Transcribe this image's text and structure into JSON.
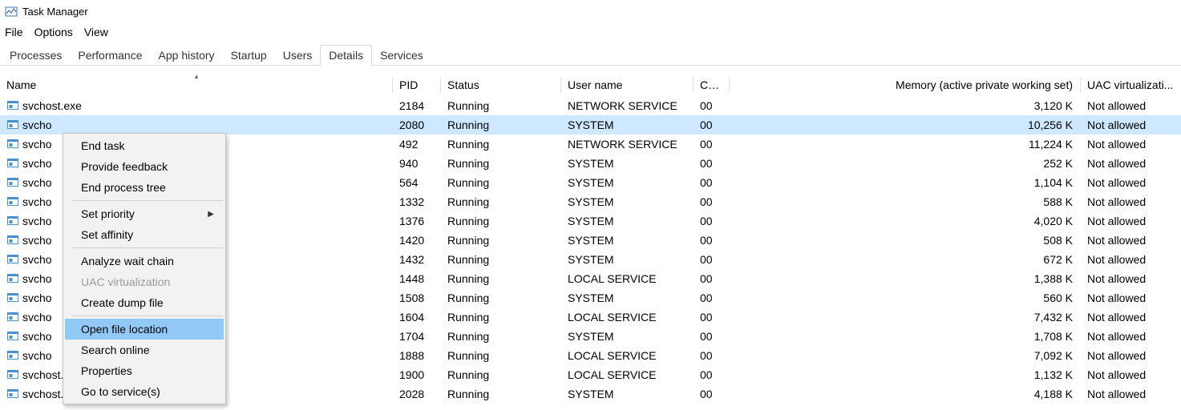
{
  "window": {
    "title": "Task Manager"
  },
  "menu": {
    "file": "File",
    "options": "Options",
    "view": "View"
  },
  "tabs": [
    {
      "label": "Processes"
    },
    {
      "label": "Performance"
    },
    {
      "label": "App history"
    },
    {
      "label": "Startup"
    },
    {
      "label": "Users"
    },
    {
      "label": "Details",
      "active": true
    },
    {
      "label": "Services"
    }
  ],
  "columns": {
    "name": "Name",
    "pid": "PID",
    "status": "Status",
    "user": "User name",
    "cpu": "CPU",
    "memory": "Memory (active private working set)",
    "uac": "UAC virtualizati..."
  },
  "rows": [
    {
      "name": "svchost.exe",
      "pid": "2184",
      "status": "Running",
      "user": "NETWORK SERVICE",
      "cpu": "00",
      "memory": "3,120 K",
      "uac": "Not allowed"
    },
    {
      "name": "svchost.exe",
      "pid": "2080",
      "status": "Running",
      "user": "SYSTEM",
      "cpu": "00",
      "memory": "10,256 K",
      "uac": "Not allowed",
      "selected": true,
      "trunc": "svcho"
    },
    {
      "name": "svchost.exe",
      "pid": "492",
      "status": "Running",
      "user": "NETWORK SERVICE",
      "cpu": "00",
      "memory": "11,224 K",
      "uac": "Not allowed",
      "trunc": "svcho"
    },
    {
      "name": "svchost.exe",
      "pid": "940",
      "status": "Running",
      "user": "SYSTEM",
      "cpu": "00",
      "memory": "252 K",
      "uac": "Not allowed",
      "trunc": "svcho"
    },
    {
      "name": "svchost.exe",
      "pid": "564",
      "status": "Running",
      "user": "SYSTEM",
      "cpu": "00",
      "memory": "1,104 K",
      "uac": "Not allowed",
      "trunc": "svcho"
    },
    {
      "name": "svchost.exe",
      "pid": "1332",
      "status": "Running",
      "user": "SYSTEM",
      "cpu": "00",
      "memory": "588 K",
      "uac": "Not allowed",
      "trunc": "svcho"
    },
    {
      "name": "svchost.exe",
      "pid": "1376",
      "status": "Running",
      "user": "SYSTEM",
      "cpu": "00",
      "memory": "4,020 K",
      "uac": "Not allowed",
      "trunc": "svcho"
    },
    {
      "name": "svchost.exe",
      "pid": "1420",
      "status": "Running",
      "user": "SYSTEM",
      "cpu": "00",
      "memory": "508 K",
      "uac": "Not allowed",
      "trunc": "svcho"
    },
    {
      "name": "svchost.exe",
      "pid": "1432",
      "status": "Running",
      "user": "SYSTEM",
      "cpu": "00",
      "memory": "672 K",
      "uac": "Not allowed",
      "trunc": "svcho"
    },
    {
      "name": "svchost.exe",
      "pid": "1448",
      "status": "Running",
      "user": "LOCAL SERVICE",
      "cpu": "00",
      "memory": "1,388 K",
      "uac": "Not allowed",
      "trunc": "svcho"
    },
    {
      "name": "svchost.exe",
      "pid": "1508",
      "status": "Running",
      "user": "SYSTEM",
      "cpu": "00",
      "memory": "560 K",
      "uac": "Not allowed",
      "trunc": "svcho"
    },
    {
      "name": "svchost.exe",
      "pid": "1604",
      "status": "Running",
      "user": "LOCAL SERVICE",
      "cpu": "00",
      "memory": "7,432 K",
      "uac": "Not allowed",
      "trunc": "svcho"
    },
    {
      "name": "svchost.exe",
      "pid": "1704",
      "status": "Running",
      "user": "SYSTEM",
      "cpu": "00",
      "memory": "1,708 K",
      "uac": "Not allowed",
      "trunc": "svcho"
    },
    {
      "name": "svchost.exe",
      "pid": "1888",
      "status": "Running",
      "user": "LOCAL SERVICE",
      "cpu": "00",
      "memory": "7,092 K",
      "uac": "Not allowed",
      "trunc": "svcho"
    },
    {
      "name": "svchost.exe",
      "pid": "1900",
      "status": "Running",
      "user": "LOCAL SERVICE",
      "cpu": "00",
      "memory": "1,132 K",
      "uac": "Not allowed",
      "trunc": "svchost.exe"
    },
    {
      "name": "svchost.exe",
      "pid": "2028",
      "status": "Running",
      "user": "SYSTEM",
      "cpu": "00",
      "memory": "4,188 K",
      "uac": "Not allowed"
    }
  ],
  "context_menu": [
    {
      "label": "End task"
    },
    {
      "label": "Provide feedback"
    },
    {
      "label": "End process tree"
    },
    {
      "sep": true
    },
    {
      "label": "Set priority",
      "submenu": true
    },
    {
      "label": "Set affinity"
    },
    {
      "sep": true
    },
    {
      "label": "Analyze wait chain"
    },
    {
      "label": "UAC virtualization",
      "disabled": true
    },
    {
      "label": "Create dump file"
    },
    {
      "sep": true
    },
    {
      "label": "Open file location",
      "highlight": true
    },
    {
      "label": "Search online"
    },
    {
      "label": "Properties"
    },
    {
      "label": "Go to service(s)"
    }
  ]
}
